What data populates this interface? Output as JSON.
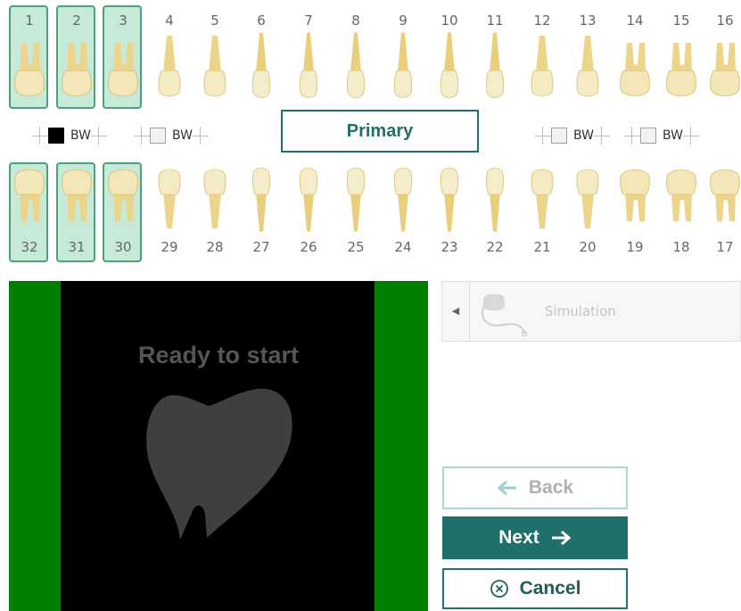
{
  "upper_teeth": [
    {
      "num": "1",
      "selected": true
    },
    {
      "num": "2",
      "selected": true
    },
    {
      "num": "3",
      "selected": true
    },
    {
      "num": "4",
      "selected": false
    },
    {
      "num": "5",
      "selected": false
    },
    {
      "num": "6",
      "selected": false
    },
    {
      "num": "7",
      "selected": false
    },
    {
      "num": "8",
      "selected": false
    },
    {
      "num": "9",
      "selected": false
    },
    {
      "num": "10",
      "selected": false
    },
    {
      "num": "11",
      "selected": false
    },
    {
      "num": "12",
      "selected": false
    },
    {
      "num": "13",
      "selected": false
    },
    {
      "num": "14",
      "selected": false
    },
    {
      "num": "15",
      "selected": false
    },
    {
      "num": "16",
      "selected": false
    }
  ],
  "lower_teeth": [
    {
      "num": "32",
      "selected": true
    },
    {
      "num": "31",
      "selected": true
    },
    {
      "num": "30",
      "selected": true
    },
    {
      "num": "29",
      "selected": false
    },
    {
      "num": "28",
      "selected": false
    },
    {
      "num": "27",
      "selected": false
    },
    {
      "num": "26",
      "selected": false
    },
    {
      "num": "25",
      "selected": false
    },
    {
      "num": "24",
      "selected": false
    },
    {
      "num": "23",
      "selected": false
    },
    {
      "num": "22",
      "selected": false
    },
    {
      "num": "21",
      "selected": false
    },
    {
      "num": "20",
      "selected": false
    },
    {
      "num": "19",
      "selected": false
    },
    {
      "num": "18",
      "selected": false
    },
    {
      "num": "17",
      "selected": false
    }
  ],
  "bitewing": [
    {
      "label": "BW",
      "checked": true
    },
    {
      "label": "BW",
      "checked": false
    },
    {
      "label": "BW",
      "checked": false
    },
    {
      "label": "BW",
      "checked": false
    }
  ],
  "primary_label": "Primary",
  "preview": {
    "status": "Ready to start"
  },
  "sensor": {
    "label": "Simulation"
  },
  "buttons": {
    "back": "Back",
    "next": "Next",
    "cancel": "Cancel"
  },
  "colors": {
    "accent": "#1f6f6a",
    "selected_fill": "#c7e9d7",
    "selected_border": "#4aa27a",
    "preview_side_bars": "#007f00"
  },
  "icons": {
    "back": "arrow-left-icon",
    "next": "arrow-right-icon",
    "cancel": "circle-x-icon",
    "sensor": "sensor-icon",
    "collapse": "chevron-left-icon",
    "preview": "tooth-logo-icon"
  }
}
